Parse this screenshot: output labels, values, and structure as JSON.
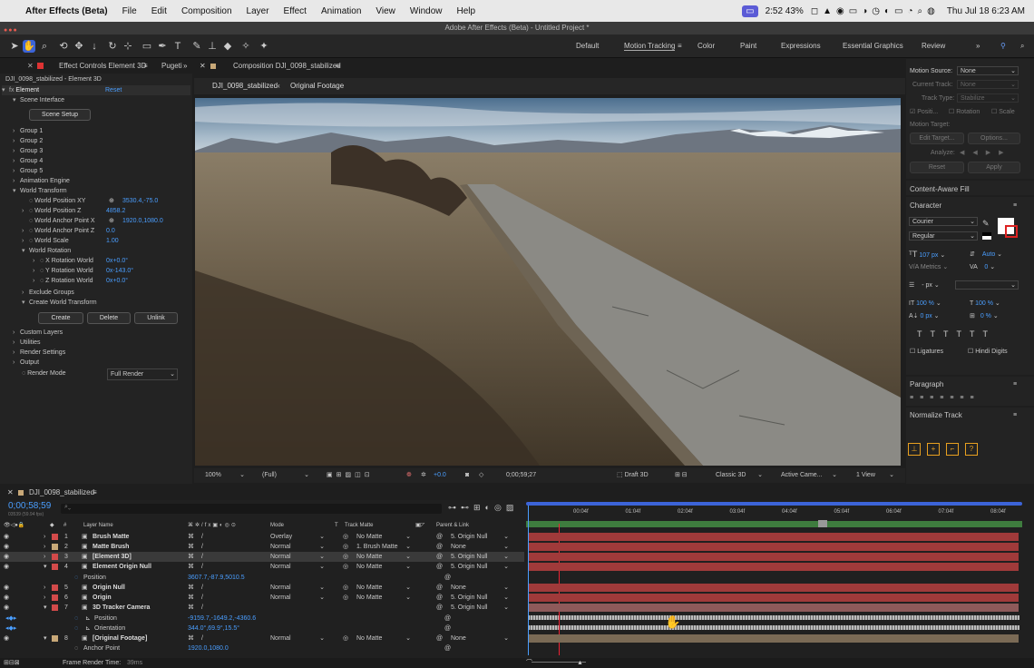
{
  "menubar": {
    "app": "After Effects (Beta)",
    "items": [
      "File",
      "Edit",
      "Composition",
      "Layer",
      "Effect",
      "Animation",
      "View",
      "Window",
      "Help"
    ],
    "battery_time": "2:52 43%",
    "datetime": "Thu Jul 18  6:23 AM"
  },
  "window": {
    "title": "Adobe After Effects (Beta) - Untitled Project *"
  },
  "workspaces": [
    "Default",
    "Motion Tracking",
    "Color",
    "Paint",
    "Expressions",
    "Essential Graphics",
    "Review"
  ],
  "effect_controls": {
    "tab": "Effect Controls Element 3D",
    "tab2": "Pugeti",
    "subtitle": "DJI_0098_stabilized - Element 3D",
    "effect": "Element",
    "reset": "Reset",
    "scene_interface": "Scene Interface",
    "scene_setup": "Scene Setup",
    "groups": [
      "Group 1",
      "Group 2",
      "Group 3",
      "Group 4",
      "Group 5",
      "Animation Engine"
    ],
    "world_transform": "World Transform",
    "props": [
      {
        "label": "World Position XY",
        "value": "3530.4,-75.0"
      },
      {
        "label": "World Position Z",
        "value": "4858.2"
      },
      {
        "label": "World Anchor Point X",
        "value": "1920.0,1080.0"
      },
      {
        "label": "World Anchor Point Z",
        "value": "0.0"
      },
      {
        "label": "World Scale",
        "value": "1.00"
      }
    ],
    "world_rotation": "World Rotation",
    "rotations": [
      {
        "label": "X Rotation World",
        "value": "0x+0.0°"
      },
      {
        "label": "Y Rotation World",
        "value": "0x-143.0°"
      },
      {
        "label": "Z Rotation World",
        "value": "0x+0.0°"
      }
    ],
    "exclude_groups": "Exclude Groups",
    "create_wt": "Create World Transform",
    "buttons": [
      "Create",
      "Delete",
      "Unlink"
    ],
    "more": [
      "Custom Layers",
      "Utilities",
      "Render Settings",
      "Output"
    ],
    "render_mode_label": "Render Mode",
    "render_mode": "Full Render"
  },
  "composition": {
    "tab": "Composition DJI_0098_stabilized",
    "crumb1": "DJI_0098_stabilized",
    "crumb2": "Original Footage",
    "footer": {
      "zoom": "100%",
      "res": "(Full)",
      "exposure": "+0.0",
      "timecode": "0;00;59;27",
      "draft": "Draft 3D",
      "renderer": "Classic 3D",
      "camera": "Active Came...",
      "view": "1 View"
    }
  },
  "tracker": {
    "motion_source_label": "Motion Source:",
    "motion_source": "None",
    "current_track_label": "Current Track:",
    "current_track": "None",
    "track_type_label": "Track Type:",
    "track_type": "Stabilize",
    "checks": [
      "Positi...",
      "Rotation",
      "Scale"
    ],
    "motion_target": "Motion Target:",
    "edit_target": "Edit Target...",
    "options": "Options...",
    "analyze": "Analyze:",
    "reset": "Reset",
    "apply": "Apply"
  },
  "right": {
    "content_aware": "Content-Aware Fill",
    "character": "Character",
    "font": "Courier",
    "style": "Regular",
    "size": "107 px",
    "leading": "Auto",
    "metrics": "Metrics",
    "tracking": "0",
    "unit": "- px",
    "vscale": "100 %",
    "hscale": "100 %",
    "baseline": "0 px",
    "tsume": "0 %",
    "ligatures": "Ligatures",
    "hindi": "Hindi Digits",
    "paragraph": "Paragraph",
    "normalize": "Normalize Track"
  },
  "timeline": {
    "tab": "DJI_0098_stabilized",
    "timecode": "0;00;58;59",
    "frames": "03539 (59.94 fps)",
    "col_layer": "Layer Name",
    "col_mode": "Mode",
    "col_t": "T",
    "col_matte": "Track Matte",
    "col_parent": "Parent & Link",
    "ruler": [
      "00:04f",
      "01:04f",
      "02:04f",
      "03:04f",
      "04:04f",
      "05:04f",
      "06:04f",
      "07:04f",
      "08:04f"
    ],
    "layers": [
      {
        "num": "1",
        "name": "Brush Matte",
        "mode": "Overlay",
        "matte": "No Matte",
        "parent": "5. Origin Null",
        "color": "#d24a4a"
      },
      {
        "num": "2",
        "name": "Matte Brush",
        "mode": "Normal",
        "matte": "1. Brush Matte",
        "parent": "None",
        "color": "#c8a878"
      },
      {
        "num": "3",
        "name": "[Element 3D]",
        "mode": "Normal",
        "matte": "No Matte",
        "parent": "5. Origin Null",
        "color": "#d24a4a"
      },
      {
        "num": "4",
        "name": "Element Origin Null",
        "mode": "Normal",
        "matte": "No Matte",
        "parent": "5. Origin Null",
        "color": "#d24a4a"
      },
      {
        "num": "5",
        "name": "Origin Null",
        "mode": "Normal",
        "matte": "No Matte",
        "parent": "None",
        "color": "#d24a4a"
      },
      {
        "num": "6",
        "name": "Origin",
        "mode": "Normal",
        "matte": "No Matte",
        "parent": "5. Origin Null",
        "color": "#d24a4a"
      },
      {
        "num": "7",
        "name": "3D Tracker Camera",
        "mode": "",
        "matte": "",
        "parent": "5. Origin Null",
        "color": "#d24a4a"
      },
      {
        "num": "8",
        "name": "[Original Footage]",
        "mode": "Normal",
        "matte": "No Matte",
        "parent": "None",
        "color": "#c8a878"
      }
    ],
    "position_label": "Position",
    "position_value": "3607.7,-87.9,5010.5",
    "cam_position_label": "Position",
    "cam_position_value": "-9159.7,-1649.2,-4360.6",
    "orientation_label": "Orientation",
    "orientation_value": "344.0°,69.9°,15.5°",
    "anchor_label": "Anchor Point",
    "anchor_value": "1920.0,1080.0",
    "render_time_label": "Frame Render Time:",
    "render_time": "39ms"
  }
}
